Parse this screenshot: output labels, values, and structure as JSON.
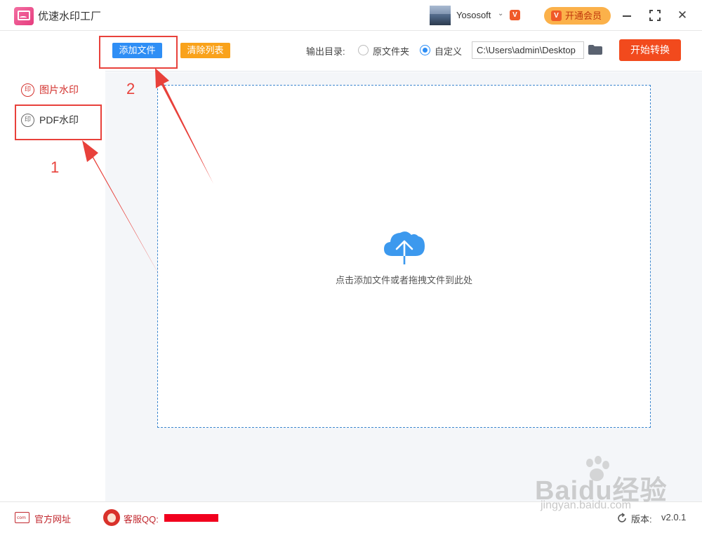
{
  "app": {
    "title": "优速水印工厂",
    "username": "Yososoft",
    "user_badge": "V",
    "vip_badge": "V",
    "vip_label": "开通会员"
  },
  "sidebar": {
    "items": [
      {
        "label": "图片水印",
        "icon": "seal-icon",
        "active": true
      },
      {
        "label": "PDF水印",
        "icon": "seal-icon",
        "active": false
      }
    ]
  },
  "toolbar": {
    "add_label": "添加文件",
    "clear_label": "清除列表",
    "output_label": "输出目录:",
    "option_original": "原文件夹",
    "option_custom": "自定义",
    "selected_option": "自定义",
    "path_value": "C:\\Users\\admin\\Desktop",
    "start_label": "开始转换"
  },
  "dropzone": {
    "hint": "点击添加文件或者拖拽文件到此处",
    "icon": "cloud-upload-icon"
  },
  "footer": {
    "site_label": "官方网址",
    "support_label": "客服QQ:",
    "version_label": "版本:",
    "version_value": "v2.0.1"
  },
  "annotations": {
    "step1": "1",
    "step2": "2",
    "color": "#e8413b"
  },
  "watermark": {
    "main": "Baidu经验",
    "sub": "jingyan.baidu.com"
  },
  "colors": {
    "primary": "#2e8ef5",
    "clear": "#f9a21b",
    "start": "#f24a1d",
    "accent_red": "#d3322e",
    "vip": "#fbb14a"
  }
}
